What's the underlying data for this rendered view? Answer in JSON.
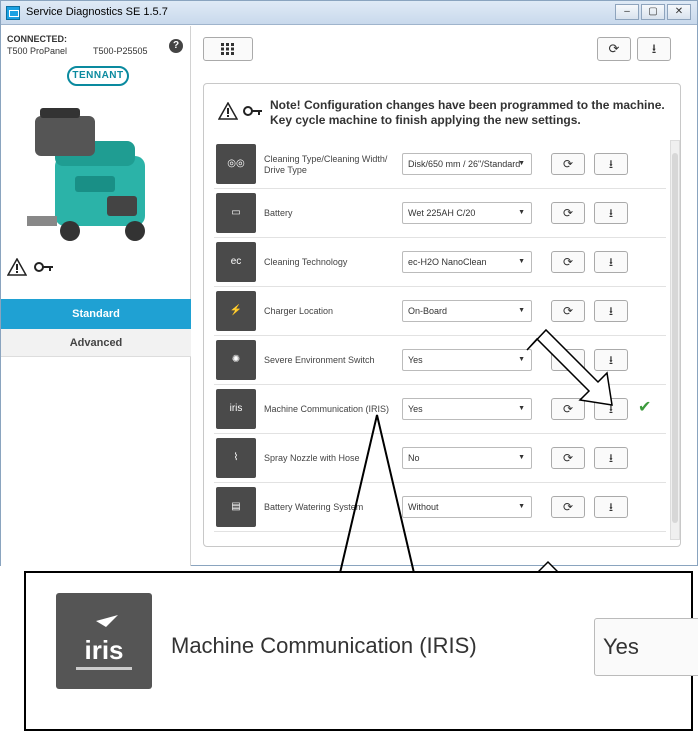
{
  "window": {
    "title": "Service Diagnostics SE 1.5.7",
    "btn_min": "–",
    "btn_max": "▢",
    "btn_close": "✕"
  },
  "left": {
    "status": "CONNECTED:",
    "model": "T500 ProPanel",
    "serial": "T500-P25505",
    "help": "?",
    "brand": "TENNANT",
    "nav": [
      "Standard",
      "Advanced"
    ]
  },
  "toolbar": {
    "grid_icon": "grid-icon",
    "refresh_icon": "refresh-icon",
    "download_icon": "download-icon"
  },
  "note": "Note! Configuration changes have been programmed to the machine. Key cycle machine to finish applying the new settings.",
  "rows": [
    {
      "icon": "cleaning-pads-icon",
      "label": "Cleaning Type/Cleaning Width/ Drive Type",
      "value": "Disk/650 mm / 26\"/Standard",
      "check": false
    },
    {
      "icon": "battery-icon",
      "label": "Battery",
      "value": "Wet 225AH C/20",
      "check": false
    },
    {
      "icon": "ec-h2o-icon",
      "label": "Cleaning Technology",
      "value": "ec-H2O NanoClean",
      "check": false
    },
    {
      "icon": "charger-icon",
      "label": "Charger Location",
      "value": "On-Board",
      "check": false
    },
    {
      "icon": "severe-environment-icon",
      "label": "Severe Environment Switch",
      "value": "Yes",
      "check": false
    },
    {
      "icon": "iris-icon",
      "label": "Machine Communication (IRIS)",
      "value": "Yes",
      "check": true
    },
    {
      "icon": "spray-nozzle-icon",
      "label": "Spray Nozzle with Hose",
      "value": "No",
      "check": false
    },
    {
      "icon": "battery-watering-icon",
      "label": "Battery Watering System",
      "value": "Without",
      "check": false
    }
  ],
  "callout": {
    "label": "Machine Communication (IRIS)",
    "value": "Yes"
  },
  "colors": {
    "accent": "#1fa1d3",
    "check": "#3c9a3c",
    "brand": "#0a8a9f"
  }
}
